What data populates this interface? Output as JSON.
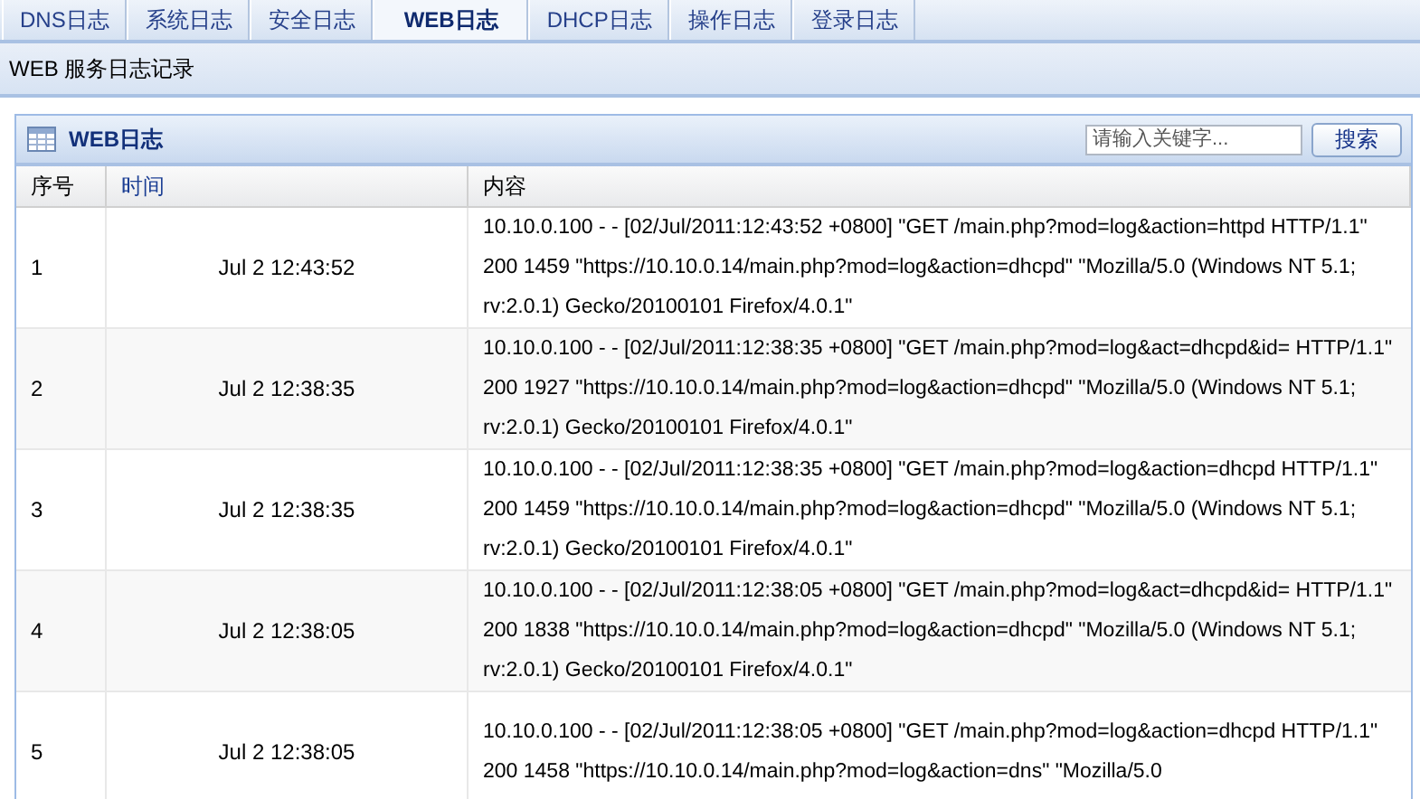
{
  "tabs": [
    {
      "label": "DNS日志",
      "selected": false
    },
    {
      "label": "系统日志",
      "selected": false
    },
    {
      "label": "安全日志",
      "selected": false
    },
    {
      "label": "WEB日志",
      "selected": true
    },
    {
      "label": "DHCP日志",
      "selected": false
    },
    {
      "label": "操作日志",
      "selected": false
    },
    {
      "label": "登录日志",
      "selected": false
    }
  ],
  "page_title": "WEB 服务日志记录",
  "panel": {
    "title": "WEB日志",
    "search": {
      "placeholder": "请输入关键字..."
    },
    "search_button": "搜索"
  },
  "table": {
    "columns": [
      "序号",
      "时间",
      "内容"
    ],
    "rows": [
      {
        "index": "1",
        "time": "Jul 2 12:43:52",
        "content": "10.10.0.100 - - [02/Jul/2011:12:43:52 +0800] \"GET /main.php?mod=log&action=httpd HTTP/1.1\" 200 1459 \"https://10.10.0.14/main.php?mod=log&action=dhcpd\" \"Mozilla/5.0 (Windows NT 5.1; rv:2.0.1) Gecko/20100101 Firefox/4.0.1\""
      },
      {
        "index": "2",
        "time": "Jul 2 12:38:35",
        "content": "10.10.0.100 - - [02/Jul/2011:12:38:35 +0800] \"GET /main.php?mod=log&act=dhcpd&id= HTTP/1.1\" 200 1927 \"https://10.10.0.14/main.php?mod=log&action=dhcpd\" \"Mozilla/5.0 (Windows NT 5.1; rv:2.0.1) Gecko/20100101 Firefox/4.0.1\""
      },
      {
        "index": "3",
        "time": "Jul 2 12:38:35",
        "content": "10.10.0.100 - - [02/Jul/2011:12:38:35 +0800] \"GET /main.php?mod=log&action=dhcpd HTTP/1.1\" 200 1459 \"https://10.10.0.14/main.php?mod=log&action=dhcpd\" \"Mozilla/5.0 (Windows NT 5.1; rv:2.0.1) Gecko/20100101 Firefox/4.0.1\""
      },
      {
        "index": "4",
        "time": "Jul 2 12:38:05",
        "content": "10.10.0.100 - - [02/Jul/2011:12:38:05 +0800] \"GET /main.php?mod=log&act=dhcpd&id= HTTP/1.1\" 200 1838 \"https://10.10.0.14/main.php?mod=log&action=dhcpd\" \"Mozilla/5.0 (Windows NT 5.1; rv:2.0.1) Gecko/20100101 Firefox/4.0.1\""
      },
      {
        "index": "5",
        "time": "Jul 2 12:38:05",
        "content": "10.10.0.100 - - [02/Jul/2011:12:38:05 +0800] \"GET /main.php?mod=log&action=dhcpd HTTP/1.1\" 200 1458 \"https://10.10.0.14/main.php?mod=log&action=dns\" \"Mozilla/5.0"
      }
    ]
  }
}
